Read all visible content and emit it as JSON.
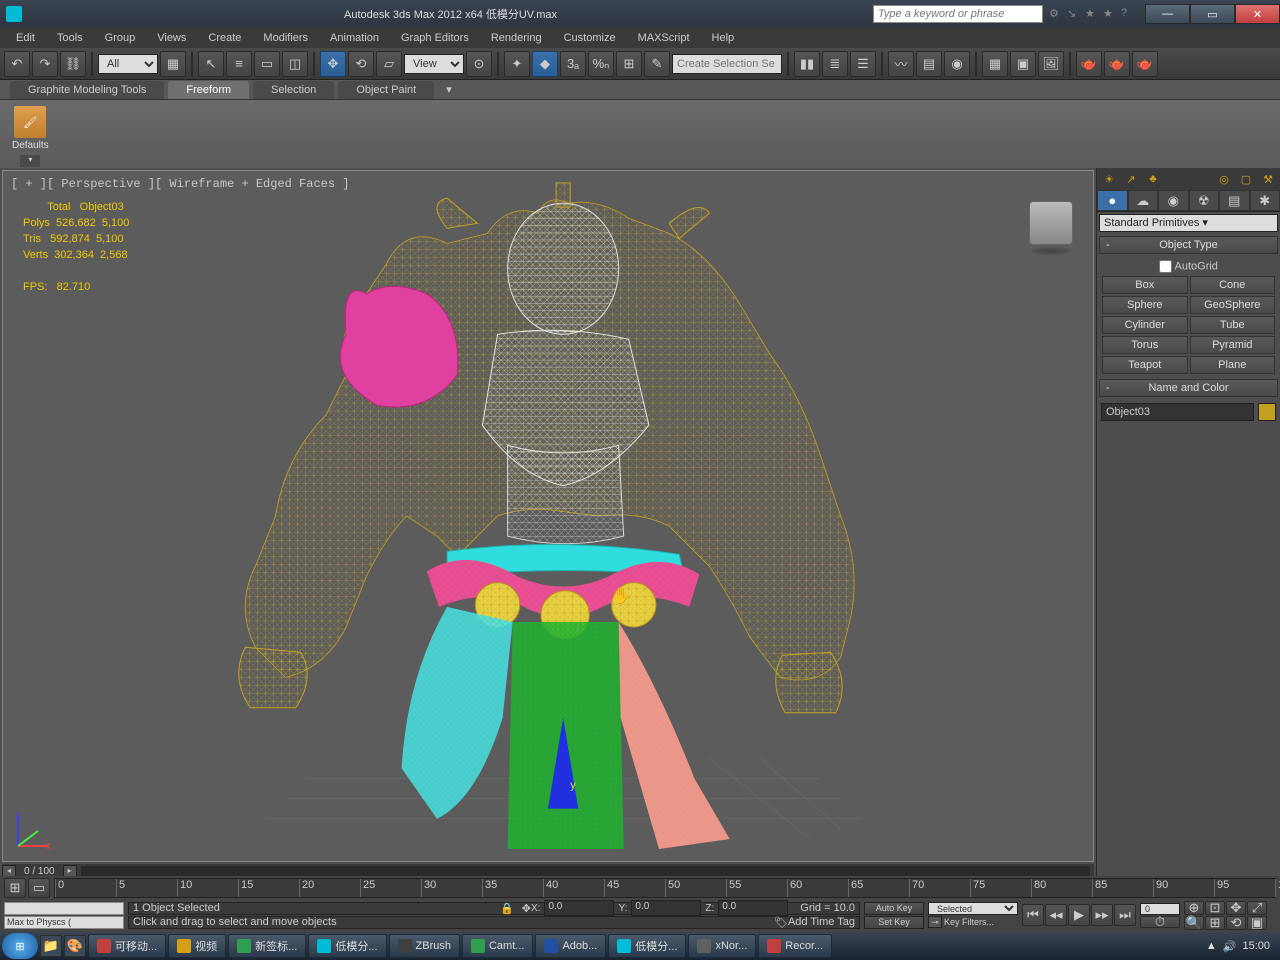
{
  "window": {
    "title": "Autodesk 3ds Max  2012 x64     低模分UV.max",
    "search_placeholder": "Type a keyword or phrase"
  },
  "menus": [
    "Edit",
    "Tools",
    "Group",
    "Views",
    "Create",
    "Modifiers",
    "Animation",
    "Graph Editors",
    "Rendering",
    "Customize",
    "MAXScript",
    "Help"
  ],
  "toolbar": {
    "filter": "All",
    "refcoord": "View",
    "selset_placeholder": "Create Selection Se"
  },
  "ribbon": {
    "tabs": [
      "Graphite Modeling Tools",
      "Freeform",
      "Selection",
      "Object Paint"
    ],
    "active": 1,
    "panel_label": "Defaults"
  },
  "viewport": {
    "label": "[ + ][ Perspective ][ Wireframe + Edged Faces ]",
    "stats": {
      "header": "        Total   Object03",
      "polys": "Polys  526,682  5,100",
      "tris": "Tris   592,874  5,100",
      "verts": "Verts  302,364  2,568",
      "fps": "FPS:   82.710"
    },
    "scrub_frame": "0 / 100"
  },
  "command_panel": {
    "dropdown": "Standard Primitives",
    "rollout1": "Object Type",
    "autogrid": "AutoGrid",
    "primitives": [
      [
        "Box",
        "Cone"
      ],
      [
        "Sphere",
        "GeoSphere"
      ],
      [
        "Cylinder",
        "Tube"
      ],
      [
        "Torus",
        "Pyramid"
      ],
      [
        "Teapot",
        "Plane"
      ]
    ],
    "rollout2": "Name and Color",
    "object_name": "Object03"
  },
  "status": {
    "selection": "1 Object Selected",
    "prompt": "Click and drag to select and move objects",
    "script_line": "Max to Physcs (",
    "x": "0.0",
    "y": "0.0",
    "z": "0.0",
    "grid": "Grid = 10.0",
    "addtag": "Add Time Tag",
    "autokey": "Auto Key",
    "setkey": "Set Key",
    "keymode": "Selected",
    "keyfilters": "Key Filters..."
  },
  "timeline": {
    "start": 0,
    "end": 100,
    "step": 5
  },
  "taskbar": {
    "items": [
      {
        "label": "可移动...",
        "color": "#c04040"
      },
      {
        "label": "视频",
        "color": "#d4a017"
      },
      {
        "label": "新签标...",
        "color": "#30a050"
      },
      {
        "label": "低模分...",
        "color": "#00bcd4"
      },
      {
        "label": "ZBrush",
        "color": "#404040"
      },
      {
        "label": "Camt...",
        "color": "#30a050"
      },
      {
        "label": "Adob...",
        "color": "#2050a0"
      },
      {
        "label": "低模分...",
        "color": "#00bcd4"
      },
      {
        "label": "xNor...",
        "color": "#606060"
      },
      {
        "label": "Recor...",
        "color": "#c04040"
      }
    ],
    "time": "15:00"
  }
}
